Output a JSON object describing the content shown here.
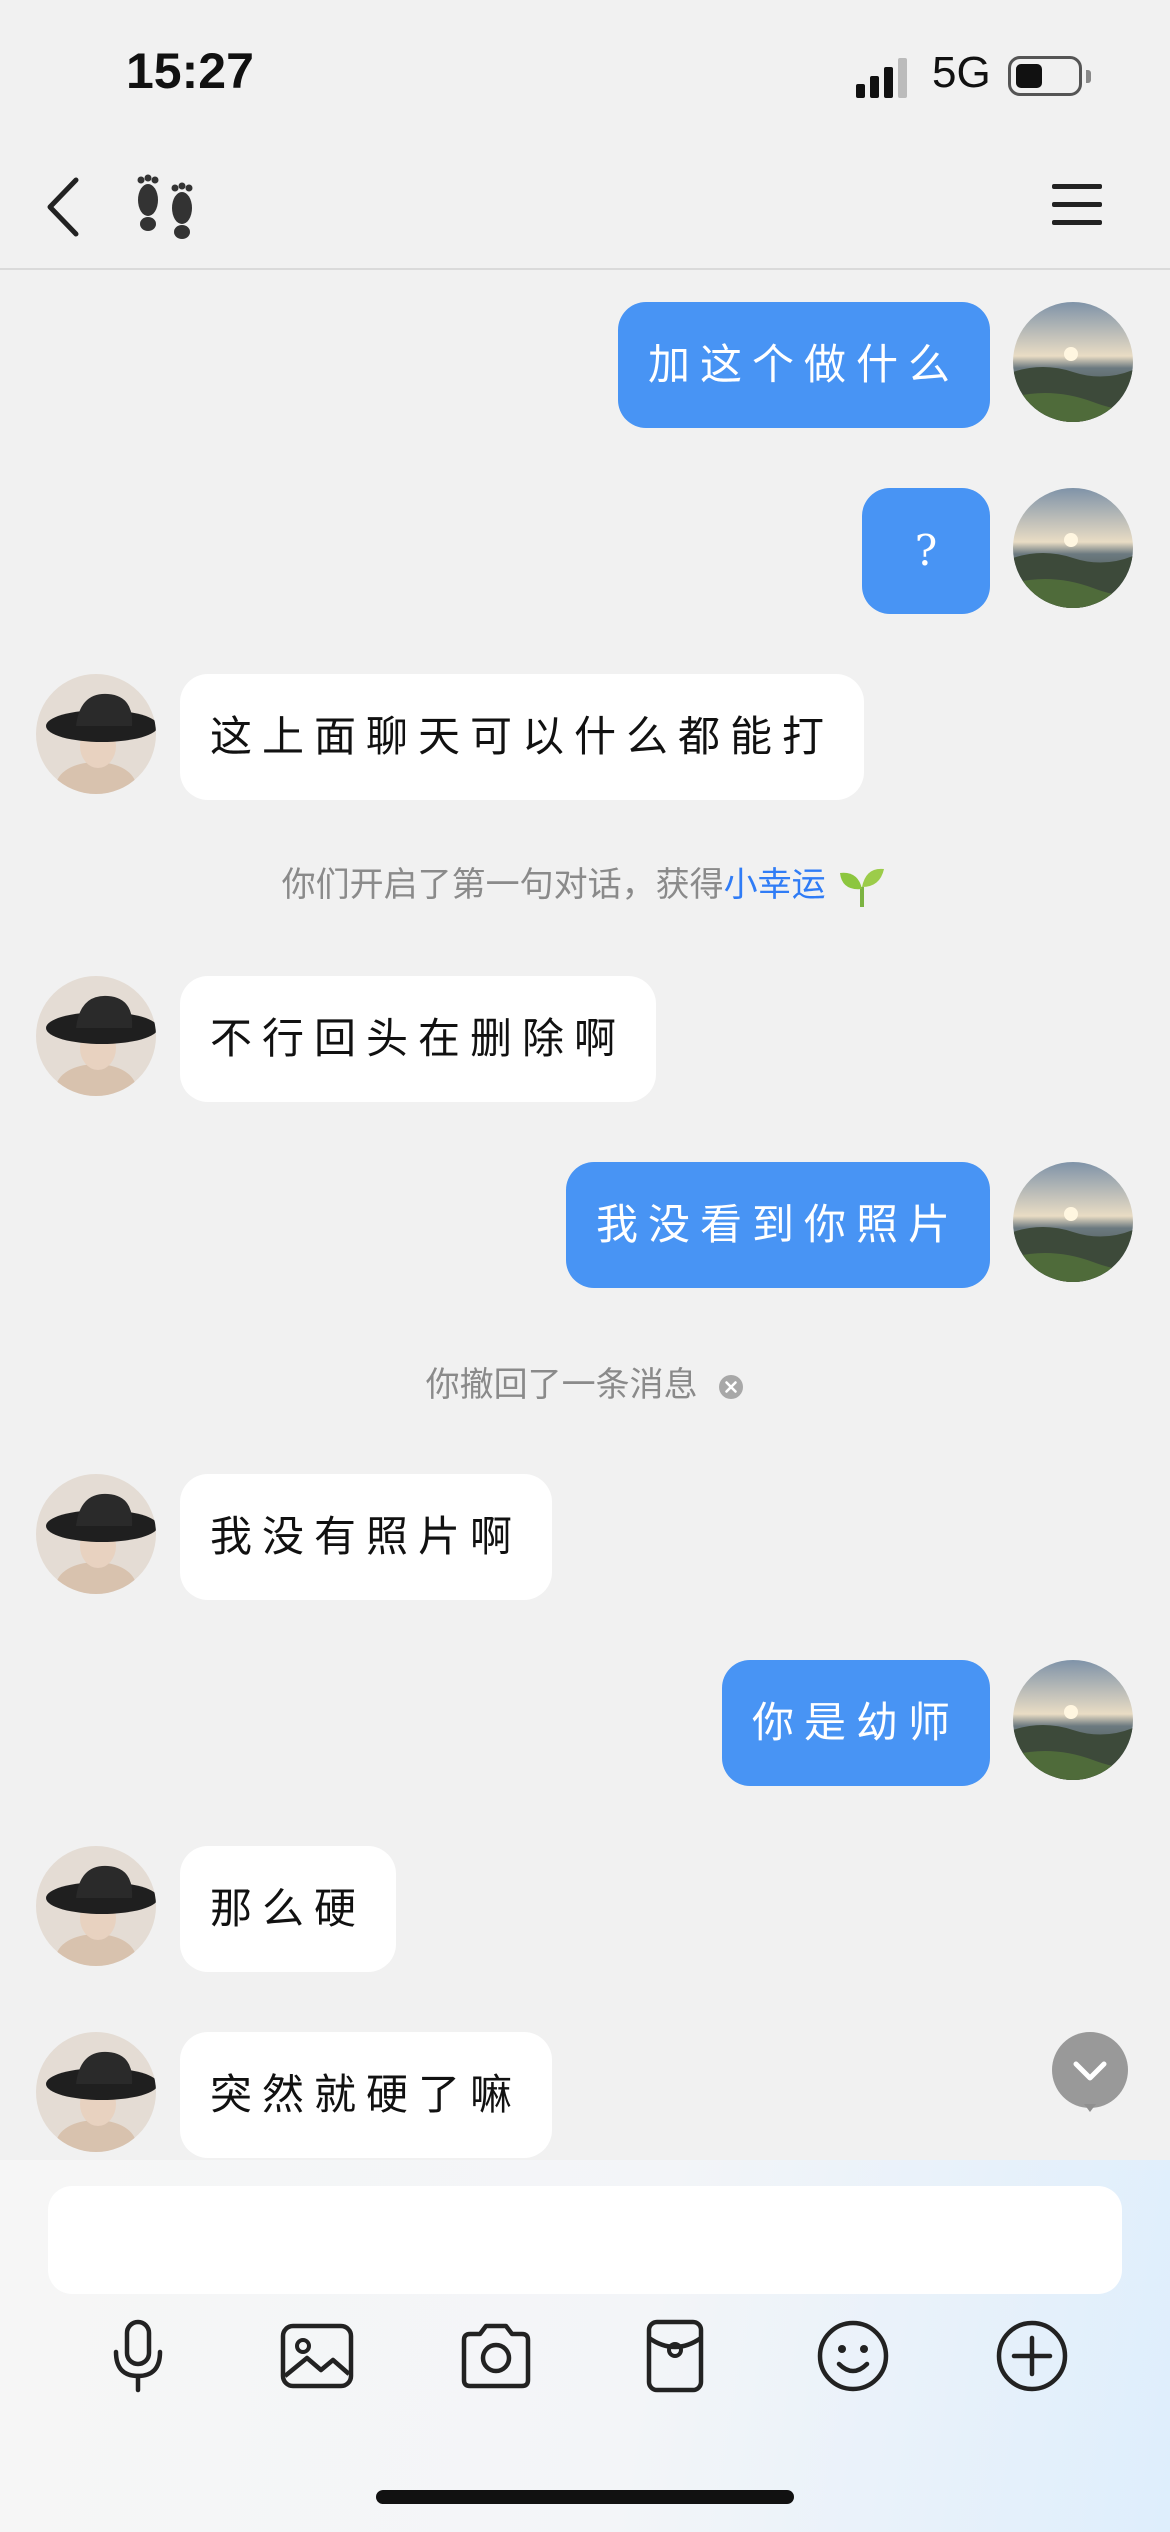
{
  "status": {
    "time": "15:27",
    "network": "5G"
  },
  "nav": {
    "back_icon": "chevron-left-icon",
    "title_icon": "footprints-icon",
    "menu_icon": "hamburger-menu-icon"
  },
  "colors": {
    "bubble_self": "#4894f4",
    "bubble_other": "#ffffff",
    "background": "#f1f1f1",
    "link": "#2f7cf6",
    "sprout": "#8cc63f"
  },
  "messages": [
    {
      "from": "me",
      "text": "加这个做什么"
    },
    {
      "from": "me",
      "text": "?"
    },
    {
      "from": "them",
      "text": "这上面聊天可以什么都能打"
    },
    {
      "from": "them",
      "text": "不行回头在删除啊"
    },
    {
      "from": "me",
      "text": "我没看到你照片"
    },
    {
      "from": "them",
      "text": "我没有照片啊"
    },
    {
      "from": "me",
      "text": "你是幼师"
    },
    {
      "from": "them",
      "text": "那么硬"
    },
    {
      "from": "them",
      "text": "突然就硬了嘛"
    }
  ],
  "system": {
    "first_chat_prefix": "你们开启了第一句对话，获得",
    "first_chat_link": "小幸运",
    "recalled": "你撤回了一条消息"
  },
  "composer": {
    "input_value": "",
    "tools": [
      "microphone-icon",
      "image-icon",
      "camera-icon",
      "red-packet-icon",
      "emoji-icon",
      "plus-icon"
    ]
  }
}
